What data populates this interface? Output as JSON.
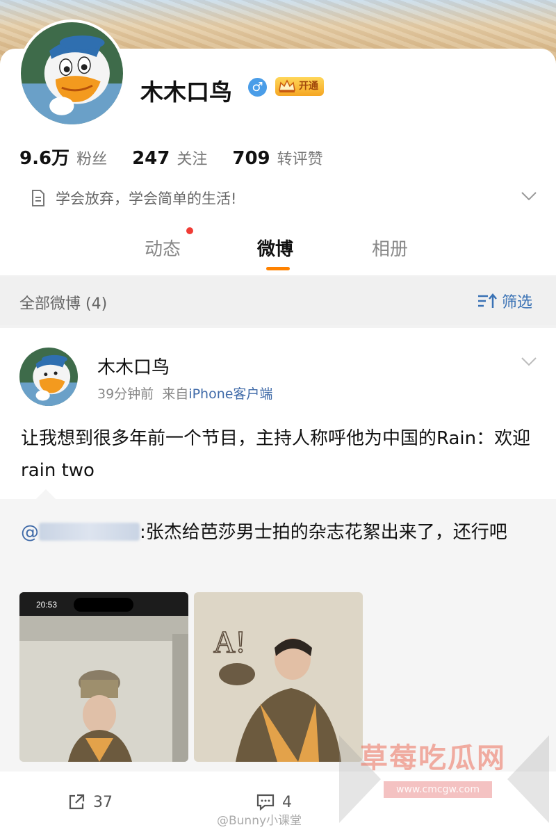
{
  "profile": {
    "username": "木木口鸟",
    "gender_icon": "male-icon",
    "gender_glyph": "♂",
    "vip_label": "开通",
    "stats": [
      {
        "value": "9.6万",
        "label": "粉丝"
      },
      {
        "value": "247",
        "label": "关注"
      },
      {
        "value": "709",
        "label": "转评赞"
      }
    ],
    "bio": "学会放弃，学会简单的生活!"
  },
  "tabs": [
    {
      "label": "动态",
      "has_dot": true
    },
    {
      "label": "微博",
      "active": true
    },
    {
      "label": "相册"
    }
  ],
  "filter": {
    "all_label": "全部微博 (4)",
    "button_label": "筛选"
  },
  "post": {
    "author": "木木口鸟",
    "time": "39分钟前",
    "source_prefix": "来自",
    "source": "iPhone客户端",
    "text": "让我想到很多年前一个节目，主持人称呼他为中国的Rain：欢迎rain two",
    "repost": {
      "at_sign": "@",
      "text": ":张杰给芭莎男士拍的杂志花絮出来了，还行吧"
    },
    "images": [
      {
        "icon": "photo-phone-screenshot",
        "status_time": "20:53"
      },
      {
        "icon": "photo-man-with-hat",
        "overlay_text": "A!"
      }
    ],
    "reposts": "37",
    "comments": "4"
  },
  "credit": "@Bunny小课堂",
  "watermark": {
    "title": "草莓吃瓜网",
    "url": "www.cmcgw.com"
  },
  "colors": {
    "accent": "#ff8200",
    "link": "#3f6aa8",
    "notification_dot": "#f03c35",
    "vip_gold": "#f5a623"
  }
}
